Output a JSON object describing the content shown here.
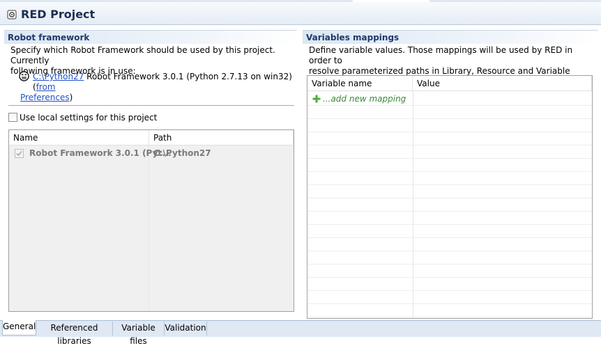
{
  "header": {
    "title": "RED Project"
  },
  "robot_framework": {
    "section_title": "Robot framework",
    "description_line1": "Specify which Robot Framework should be used by this project. Currently",
    "description_line2": "following framework is in use:",
    "python_path_link": "C:\\Python27",
    "framework_info": " Robot Framework 3.0.1 (Python 2.7.13 on win32) (",
    "from_link": "from",
    "preferences_link": "Preferences",
    "closing_paren": ")",
    "use_local_label": "Use local settings for this project",
    "use_local_checked": false,
    "table": {
      "columns": [
        "Name",
        "Path"
      ],
      "rows": [
        {
          "name": "Robot Framework 3.0.1 (Pyt...",
          "path": "C:\\Python27",
          "checked": true
        }
      ]
    }
  },
  "variables": {
    "section_title": "Variables mappings",
    "description_line1": "Define variable values. Those mappings will be used by RED in order to",
    "description_line2": "resolve parameterized paths in Library, Resource and Variable settings.",
    "table": {
      "columns": [
        "Variable name",
        "Value"
      ],
      "add_label": "...add new mapping"
    }
  },
  "tabs": [
    {
      "label": "General",
      "active": true
    },
    {
      "label": "Referenced libraries",
      "active": false
    },
    {
      "label": "Variable files",
      "active": false
    },
    {
      "label": "Validation",
      "active": false
    }
  ],
  "colors": {
    "title": "#1d2f52",
    "section_title": "#1d3a6a",
    "link": "#1f51c6",
    "add_mapping": "#3a8a3a",
    "disabled_text": "#7a7a7a"
  },
  "icons": {
    "project": "project-gear-icon",
    "python": "robot-face-icon",
    "add": "plus-icon",
    "checked": "checkmark-icon"
  }
}
